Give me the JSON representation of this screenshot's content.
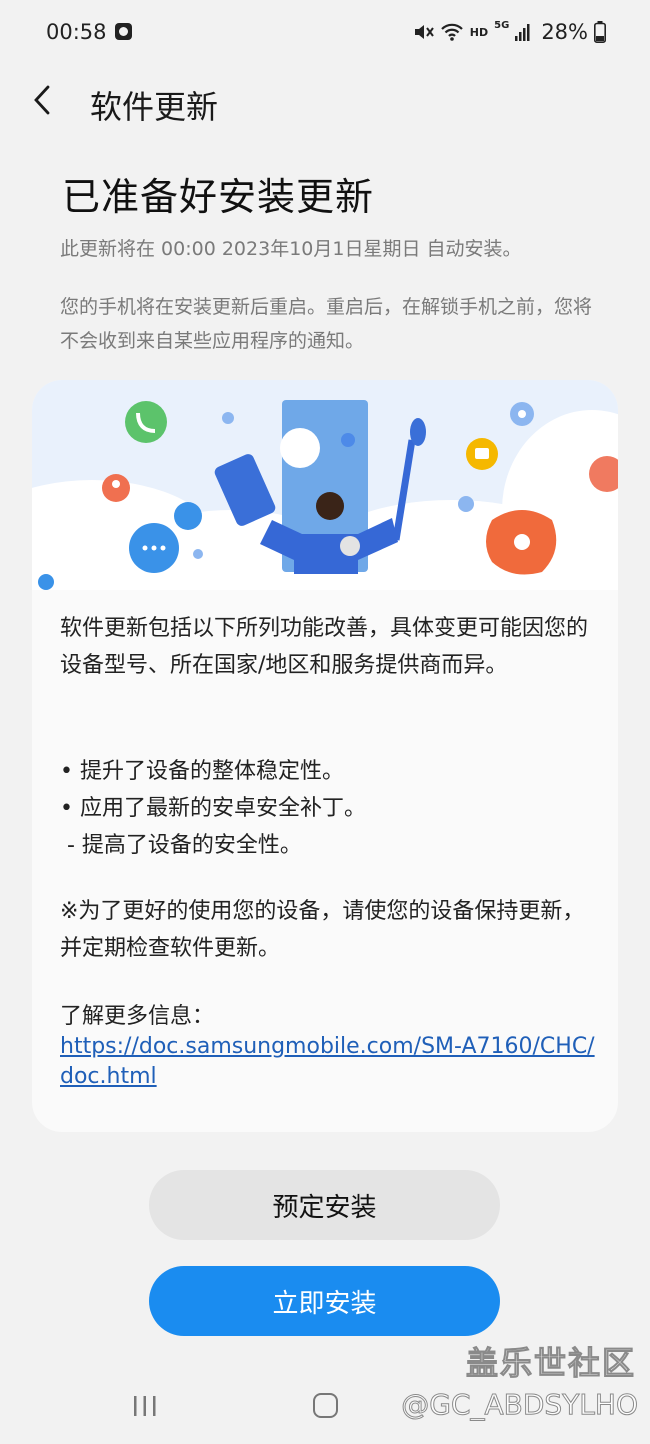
{
  "status_bar": {
    "time": "00:58",
    "network": "HD",
    "signal_type": "5G",
    "battery": "28%"
  },
  "header": {
    "title": "软件更新",
    "back_icon": "chevron-left-icon"
  },
  "main": {
    "title": "已准备好安装更新",
    "schedule_text": "此更新将在 00:00 2023年10月1日星期日 自动安装。",
    "restart_notice": "您的手机将在安装更新后重启。重启后，在解锁手机之前，您将不会收到来自某些应用程序的通知。"
  },
  "card": {
    "intro": "软件更新包括以下所列功能改善，具体变更可能因您的设备型号、所在国家/地区和服务提供商而异。",
    "bullets": [
      "• 提升了设备的整体稳定性。",
      "• 应用了最新的安卓安全补丁。",
      " - 提高了设备的安全性。"
    ],
    "note": "※为了更好的使用您的设备，请使您的设备保持更新，并定期检查软件更新。",
    "more_label": "了解更多信息：",
    "more_link": "https://doc.samsungmobile.com/SM-A7160/CHC/doc.html"
  },
  "buttons": {
    "schedule": "预定安装",
    "install_now": "立即安装"
  },
  "watermark": {
    "line1": "盖乐世社区",
    "line2": "@GC_ABDSYLHO"
  },
  "colors": {
    "primary_button": "#1a8cf0",
    "link": "#1f5fb8",
    "background": "#f2f2f2"
  }
}
